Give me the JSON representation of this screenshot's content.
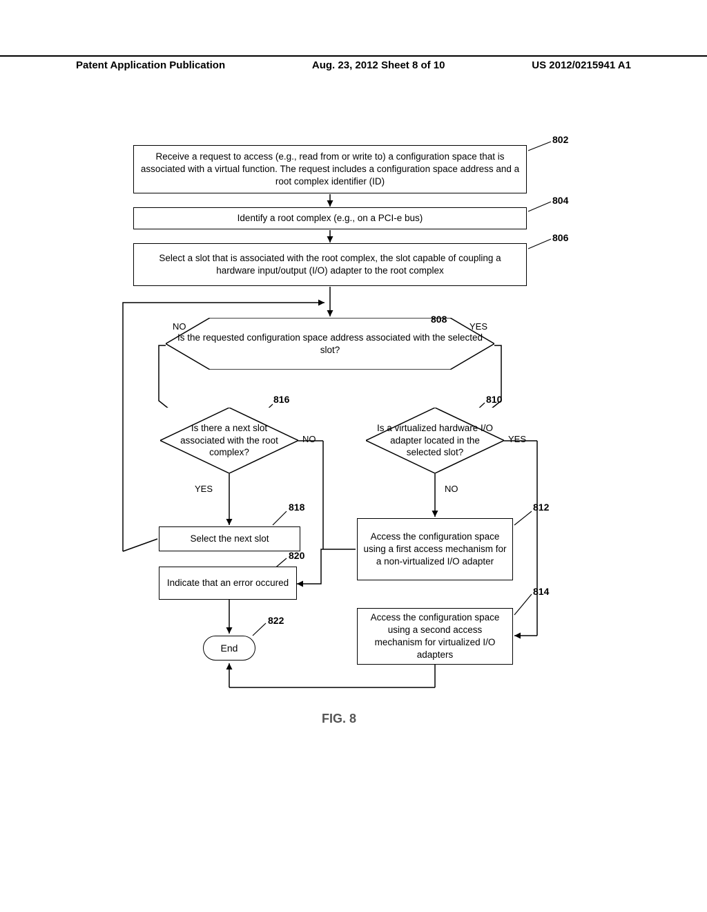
{
  "header": {
    "left": "Patent Application Publication",
    "center": "Aug. 23, 2012  Sheet 8 of 10",
    "right": "US 2012/0215941 A1"
  },
  "boxes": {
    "b802": "Receive a request to access (e.g., read from or write to) a configuration space that is associated with a virtual function. The request includes a configuration space address and a root complex identifier (ID)",
    "b804": "Identify a root complex (e.g., on a PCI-e bus)",
    "b806": "Select a slot that is associated with the root complex, the slot capable of coupling a hardware input/output (I/O) adapter to the root complex",
    "d808": "Is the requested configuration space address associated with the selected slot?",
    "d816": "Is there a next slot associated with the root complex?",
    "d810": "Is a virtualized hardware I/O adapter located in the selected slot?",
    "b818": "Select the next slot",
    "b820": "Indicate that an error occured",
    "b812": "Access the configuration space using a first access mechanism for a non-virtualized I/O adapter",
    "b814": "Access the configuration space using a second access mechanism for virtualized I/O adapters",
    "end": "End"
  },
  "refs": {
    "r802": "802",
    "r804": "804",
    "r806": "806",
    "r808": "808",
    "r810": "810",
    "r812": "812",
    "r814": "814",
    "r816": "816",
    "r818": "818",
    "r820": "820",
    "r822": "822"
  },
  "labels": {
    "no": "NO",
    "yes": "YES"
  },
  "figcaption": "FIG. 8"
}
